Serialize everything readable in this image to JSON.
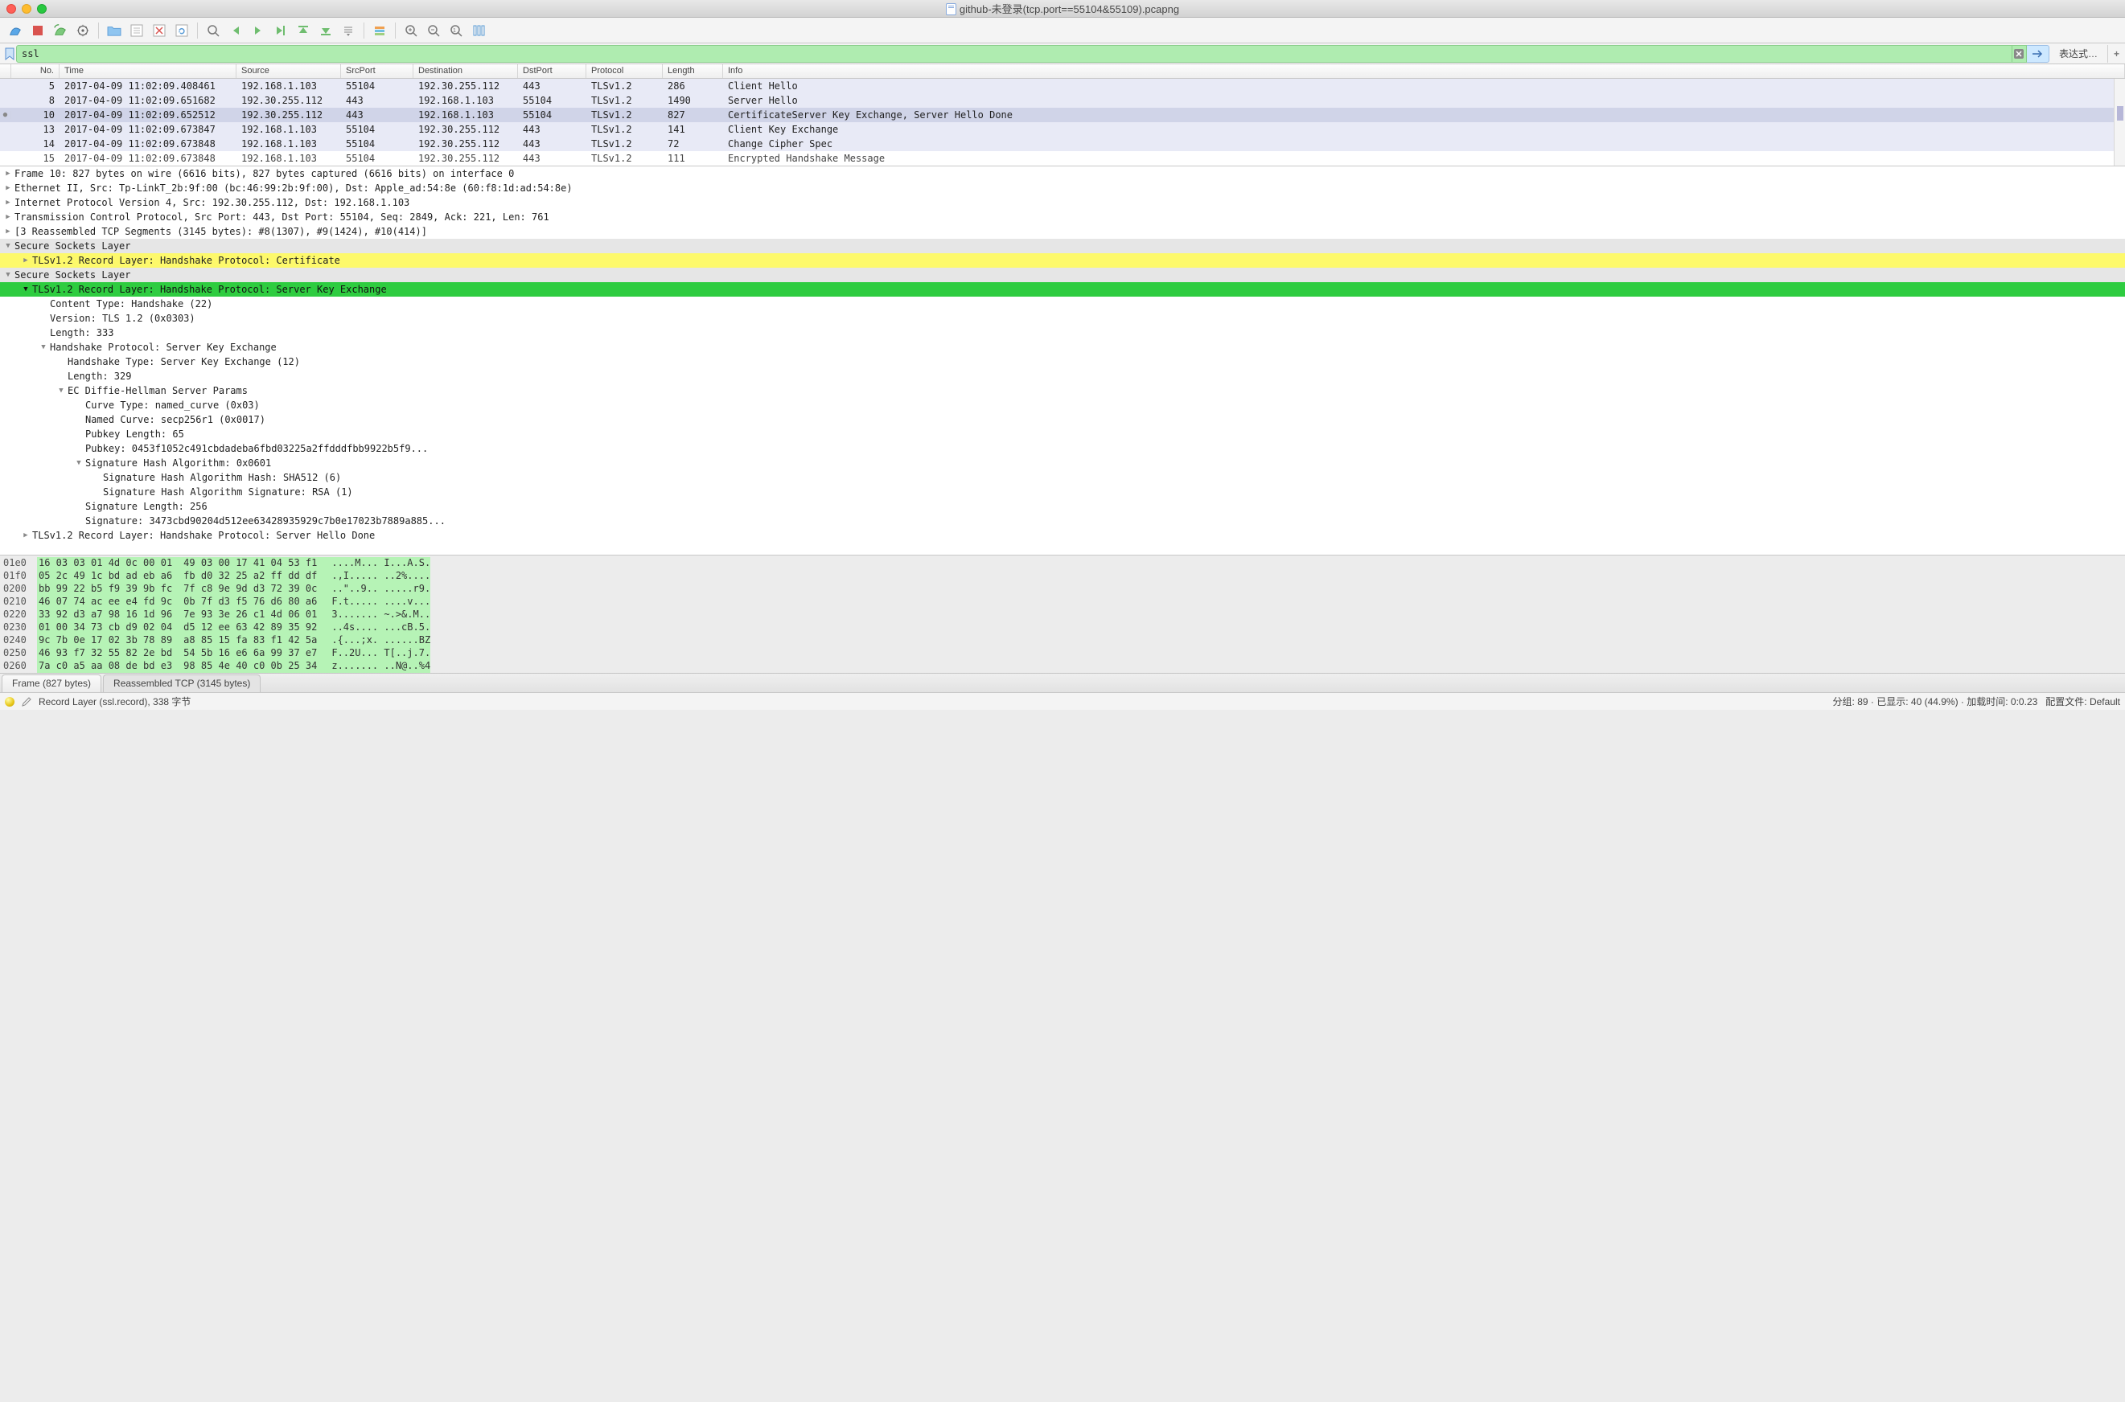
{
  "window": {
    "title": "github-未登录(tcp.port==55104&55109).pcapng"
  },
  "filter": {
    "value": "ssl",
    "expression_label": "表达式…",
    "plus": "+"
  },
  "columns": {
    "no": "No.",
    "time": "Time",
    "src": "Source",
    "srcport": "SrcPort",
    "dst": "Destination",
    "dstport": "DstPort",
    "proto": "Protocol",
    "len": "Length",
    "info": "Info"
  },
  "packets": [
    {
      "no": "5",
      "time": "2017-04-09 11:02:09.408461",
      "src": "192.168.1.103",
      "sp": "55104",
      "dst": "192.30.255.112",
      "dp": "443",
      "proto": "TLSv1.2",
      "len": "286",
      "info": "Client Hello",
      "cls": "light"
    },
    {
      "no": "8",
      "time": "2017-04-09 11:02:09.651682",
      "src": "192.30.255.112",
      "sp": "443",
      "dst": "192.168.1.103",
      "dp": "55104",
      "proto": "TLSv1.2",
      "len": "1490",
      "info": "Server Hello",
      "cls": "light"
    },
    {
      "no": "10",
      "time": "2017-04-09 11:02:09.652512",
      "src": "192.30.255.112",
      "sp": "443",
      "dst": "192.168.1.103",
      "dp": "55104",
      "proto": "TLSv1.2",
      "len": "827",
      "info": "CertificateServer Key Exchange, Server Hello Done",
      "cls": "sel",
      "mark": "●"
    },
    {
      "no": "13",
      "time": "2017-04-09 11:02:09.673847",
      "src": "192.168.1.103",
      "sp": "55104",
      "dst": "192.30.255.112",
      "dp": "443",
      "proto": "TLSv1.2",
      "len": "141",
      "info": "Client Key Exchange",
      "cls": "light"
    },
    {
      "no": "14",
      "time": "2017-04-09 11:02:09.673848",
      "src": "192.168.1.103",
      "sp": "55104",
      "dst": "192.30.255.112",
      "dp": "443",
      "proto": "TLSv1.2",
      "len": "72",
      "info": "Change Cipher Spec",
      "cls": "light"
    },
    {
      "no": "15",
      "time": "2017-04-09 11:02:09.673848",
      "src": "192.168.1.103",
      "sp": "55104",
      "dst": "192.30.255.112",
      "dp": "443",
      "proto": "TLSv1.2",
      "len": "111",
      "info": "Encrypted Handshake Message",
      "cls": "cut"
    }
  ],
  "details": [
    {
      "tri": "▶",
      "txt": "Frame 10: 827 bytes on wire (6616 bits), 827 bytes captured (6616 bits) on interface 0",
      "lvl": 0
    },
    {
      "tri": "▶",
      "txt": "Ethernet II, Src: Tp-LinkT_2b:9f:00 (bc:46:99:2b:9f:00), Dst: Apple_ad:54:8e (60:f8:1d:ad:54:8e)",
      "lvl": 0
    },
    {
      "tri": "▶",
      "txt": "Internet Protocol Version 4, Src: 192.30.255.112, Dst: 192.168.1.103",
      "lvl": 0
    },
    {
      "tri": "▶",
      "txt": "Transmission Control Protocol, Src Port: 443, Dst Port: 55104, Seq: 2849, Ack: 221, Len: 761",
      "lvl": 0
    },
    {
      "tri": "▶",
      "txt": "[3 Reassembled TCP Segments (3145 bytes): #8(1307), #9(1424), #10(414)]",
      "lvl": 0
    },
    {
      "tri": "▼",
      "txt": "Secure Sockets Layer",
      "lvl": 0,
      "hl": "grey"
    },
    {
      "tri": "▶",
      "txt": "TLSv1.2 Record Layer: Handshake Protocol: Certificate",
      "lvl": 1,
      "hl": "yellow"
    },
    {
      "tri": "▼",
      "txt": "Secure Sockets Layer",
      "lvl": 0,
      "hl": "grey"
    },
    {
      "tri": "▼",
      "txt": "TLSv1.2 Record Layer: Handshake Protocol: Server Key Exchange",
      "lvl": 1,
      "hl": "green"
    },
    {
      "tri": "",
      "txt": "Content Type: Handshake (22)",
      "lvl": 2
    },
    {
      "tri": "",
      "txt": "Version: TLS 1.2 (0x0303)",
      "lvl": 2
    },
    {
      "tri": "",
      "txt": "Length: 333",
      "lvl": 2
    },
    {
      "tri": "▼",
      "txt": "Handshake Protocol: Server Key Exchange",
      "lvl": 2
    },
    {
      "tri": "",
      "txt": "Handshake Type: Server Key Exchange (12)",
      "lvl": 3
    },
    {
      "tri": "",
      "txt": "Length: 329",
      "lvl": 3
    },
    {
      "tri": "▼",
      "txt": "EC Diffie-Hellman Server Params",
      "lvl": 3
    },
    {
      "tri": "",
      "txt": "Curve Type: named_curve (0x03)",
      "lvl": 4
    },
    {
      "tri": "",
      "txt": "Named Curve: secp256r1 (0x0017)",
      "lvl": 4
    },
    {
      "tri": "",
      "txt": "Pubkey Length: 65",
      "lvl": 4
    },
    {
      "tri": "",
      "txt": "Pubkey: 0453f1052c491cbdadeba6fbd03225a2ffdddfbb9922b5f9...",
      "lvl": 4
    },
    {
      "tri": "▼",
      "txt": "Signature Hash Algorithm: 0x0601",
      "lvl": 4
    },
    {
      "tri": "",
      "txt": "Signature Hash Algorithm Hash: SHA512 (6)",
      "lvl": 5
    },
    {
      "tri": "",
      "txt": "Signature Hash Algorithm Signature: RSA (1)",
      "lvl": 5
    },
    {
      "tri": "",
      "txt": "Signature Length: 256",
      "lvl": 4
    },
    {
      "tri": "",
      "txt": "Signature: 3473cbd90204d512ee63428935929c7b0e17023b7889a885...",
      "lvl": 4
    },
    {
      "tri": "▶",
      "txt": "TLSv1.2 Record Layer: Handshake Protocol: Server Hello Done",
      "lvl": 1
    }
  ],
  "hex": [
    {
      "off": "01e0",
      "b1": "16 03 03 01 4d 0c 00 01",
      "b2": "49 03 00 17 41 04 53 f1",
      "a": "....M... I...A.S."
    },
    {
      "off": "01f0",
      "b1": "05 2c 49 1c bd ad eb a6",
      "b2": "fb d0 32 25 a2 ff dd df",
      "a": ".,I..... ..2%...."
    },
    {
      "off": "0200",
      "b1": "bb 99 22 b5 f9 39 9b fc",
      "b2": "7f c8 9e 9d d3 72 39 0c",
      "a": "..\"..9.. .....r9."
    },
    {
      "off": "0210",
      "b1": "46 07 74 ac ee e4 fd 9c",
      "b2": "0b 7f d3 f5 76 d6 80 a6",
      "a": "F.t..... ....v..."
    },
    {
      "off": "0220",
      "b1": "33 92 d3 a7 98 16 1d 96",
      "b2": "7e 93 3e 26 c1 4d 06 01",
      "a": "3....... ~.>&.M.."
    },
    {
      "off": "0230",
      "b1": "01 00 34 73 cb d9 02 04",
      "b2": "d5 12 ee 63 42 89 35 92",
      "a": "..4s.... ...cB.5."
    },
    {
      "off": "0240",
      "b1": "9c 7b 0e 17 02 3b 78 89",
      "b2": "a8 85 15 fa 83 f1 42 5a",
      "a": ".{...;x. ......BZ"
    },
    {
      "off": "0250",
      "b1": "46 93 f7 32 55 82 2e bd",
      "b2": "54 5b 16 e6 6a 99 37 e7",
      "a": "F..2U... T[..j.7."
    },
    {
      "off": "0260",
      "b1": "7a c0 a5 aa 08 de bd e3",
      "b2": "98 85 4e 40 c0 0b 25 34",
      "a": "z....... ..N@..%4"
    }
  ],
  "tabs": {
    "frame": "Frame (827 bytes)",
    "reasm": "Reassembled TCP (3145 bytes)"
  },
  "status": {
    "desc": "Record Layer (ssl.record), 338 字节",
    "pkts": "分组: 89 · 已显示: 40 (44.9%) · 加载时间: 0:0.23",
    "profile": "配置文件: Default"
  }
}
